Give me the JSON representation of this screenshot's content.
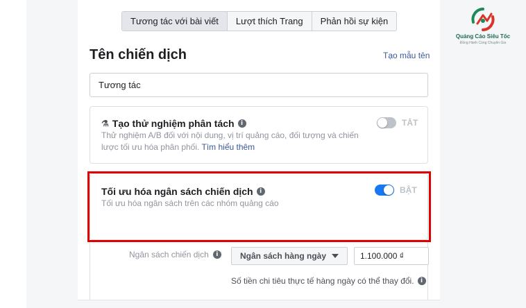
{
  "tabs": [
    {
      "label": "Tương tác với bài viết",
      "active": true
    },
    {
      "label": "Lượt thích Trang",
      "active": false
    },
    {
      "label": "Phản hồi sự kiện",
      "active": false
    }
  ],
  "brand": {
    "name": "Quảng Cáo Siêu Tốc",
    "tagline": "Đồng Hành Cùng Chuyên Gia",
    "colors": {
      "green": "#1d8a5a",
      "red": "#d9342b"
    }
  },
  "campaign": {
    "title": "Tên chiến dịch",
    "template_link": "Tạo mẫu tên",
    "name_value": "Tương tác"
  },
  "ab_test": {
    "title": "Tạo thử nghiệm phân tách",
    "description": "Thử nghiệm A/B đối với nội dung, vị trí quảng cáo, đối tượng và chiến lược tối ưu hóa phân phối. ",
    "learn_more": "Tìm hiểu thêm",
    "toggle_label": "TẮT",
    "enabled": false
  },
  "cbo": {
    "title": "Tối ưu hóa ngân sách chiến dịch",
    "description": "Tối ưu hóa ngân sách trên các nhóm quảng cáo",
    "toggle_label": "BẬT",
    "enabled": true
  },
  "budget": {
    "label": "Ngân sách chiến dịch",
    "type_selected": "Ngân sách hàng ngày",
    "amount": "1.100.000 ₫",
    "note": "Số tiền chi tiêu thực tế hàng ngày có thể thay đổi."
  },
  "colors": {
    "accent": "#1877f2",
    "link": "#385898",
    "highlight": "#e00000"
  }
}
